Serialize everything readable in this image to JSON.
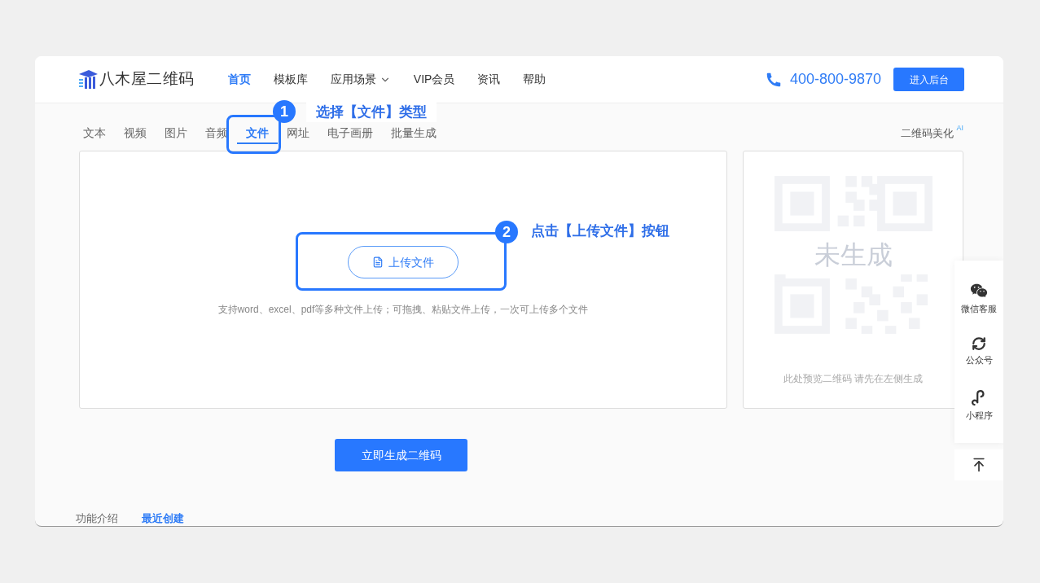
{
  "header": {
    "logo": "八木屋二维码",
    "nav": [
      {
        "label": "首页",
        "selected": true,
        "has_menu": false
      },
      {
        "label": "模板库",
        "selected": false,
        "has_menu": false
      },
      {
        "label": "应用场景",
        "selected": false,
        "has_menu": true
      },
      {
        "label": "VIP会员",
        "selected": false,
        "has_menu": false
      },
      {
        "label": "资讯",
        "selected": false,
        "has_menu": false
      },
      {
        "label": "帮助",
        "selected": false,
        "has_menu": false
      }
    ],
    "phone": "400-800-9870",
    "backend_button": "进入后台"
  },
  "type_tabs": [
    {
      "label": "文本",
      "selected": false
    },
    {
      "label": "视频",
      "selected": false
    },
    {
      "label": "图片",
      "selected": false
    },
    {
      "label": "音频",
      "selected": false
    },
    {
      "label": "文件",
      "selected": true
    },
    {
      "label": "网址",
      "selected": false
    },
    {
      "label": "电子画册",
      "selected": false
    },
    {
      "label": "批量生成",
      "selected": false
    }
  ],
  "beautify": {
    "label": "二维码美化",
    "badge": "AI"
  },
  "upload": {
    "button": "上传文件",
    "hint": "支持word、excel、pdf等多种文件上传；可拖拽、粘贴文件上传，一次可上传多个文件"
  },
  "preview": {
    "watermark": "未生成",
    "hint": "此处预览二维码 请先在左侧生成"
  },
  "generate_button": "立即生成二维码",
  "bottom_tabs": [
    {
      "label": "功能介绍",
      "selected": false
    },
    {
      "label": "最近创建",
      "selected": true
    }
  ],
  "side_toolbar": [
    {
      "kind": "wechat",
      "label": "微信客服"
    },
    {
      "kind": "official",
      "label": "公众号"
    },
    {
      "kind": "miniprogram",
      "label": "小程序"
    }
  ],
  "annotations": [
    {
      "number": "1",
      "text": "选择【文件】类型"
    },
    {
      "number": "2",
      "text": "点击【上传文件】按钮"
    }
  ]
}
